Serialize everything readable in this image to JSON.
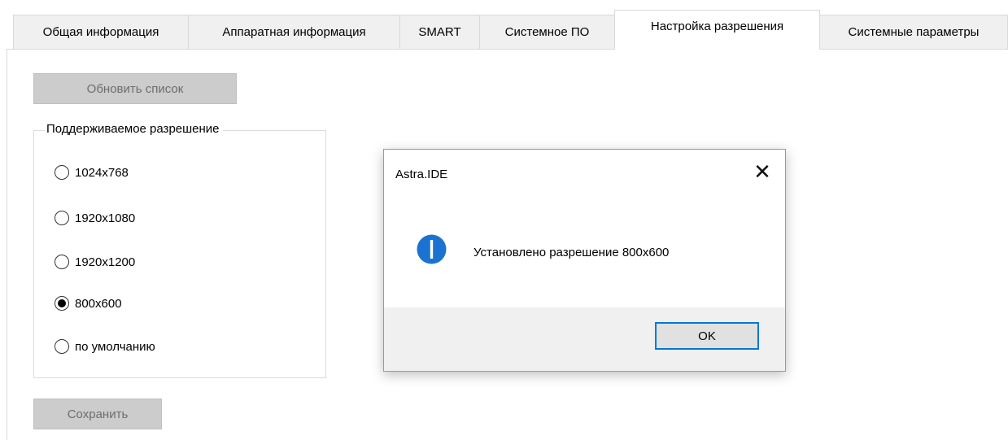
{
  "tabs": [
    {
      "label": "Общая информация"
    },
    {
      "label": "Аппаратная информация"
    },
    {
      "label": "SMART"
    },
    {
      "label": "Системное ПО"
    },
    {
      "label": "Настройка разрешения"
    },
    {
      "label": "Системные параметры"
    }
  ],
  "active_tab": "Настройка разрешения",
  "refresh_button": {
    "label": "Обновить список"
  },
  "resolution_group": {
    "legend": "Поддерживаемое разрешение",
    "options": [
      {
        "label": "1024x768",
        "checked": false
      },
      {
        "label": "1920x1080",
        "checked": false
      },
      {
        "label": "1920x1200",
        "checked": false
      },
      {
        "label": "800x600",
        "checked": true
      },
      {
        "label": "по умолчанию",
        "checked": false
      }
    ]
  },
  "save_button": {
    "label": "Сохранить"
  },
  "dialog": {
    "title": "Astra.IDE",
    "close_glyph": "✕",
    "icon": "info-icon",
    "message": "Установлено разрешение 800x600",
    "ok_label": "OK"
  },
  "colors": {
    "accent": "#0078d7",
    "disabled_button": "#cccccc",
    "dialog_footer": "#f0f0f0"
  }
}
